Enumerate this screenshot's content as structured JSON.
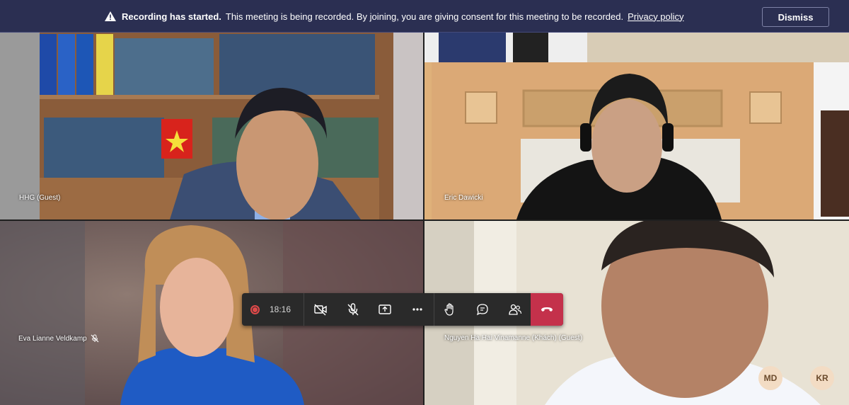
{
  "banner": {
    "title": "Recording has started.",
    "message": "This meeting is being recorded. By joining, you are giving consent for this meeting to be recorded.",
    "link": "Privacy policy",
    "dismiss_label": "Dismiss"
  },
  "participants": [
    {
      "name": "HHG (Guest)"
    },
    {
      "name": "Eric Dawicki"
    },
    {
      "name": "Eva Lianne Veldkamp",
      "mic": "mic-off-icon"
    },
    {
      "name": "Nguyen Ha Hai Vinamanne (Khách) (Guest)"
    }
  ],
  "toolbar": {
    "timer": "18:16",
    "buttons": [
      "camera-off-icon",
      "mic-off-icon",
      "share-screen-icon",
      "more-icon",
      "raise-hand-icon",
      "chat-icon",
      "participants-icon",
      "hang-up-icon"
    ]
  },
  "avatars": [
    {
      "initials": "MD"
    },
    {
      "initials": "KR"
    }
  ],
  "colors": {
    "banner_bg": "#2b2f52",
    "toolbar_bg": "#2a2a2a",
    "hangup": "#c4314b",
    "record": "#e04a4a",
    "avatar_bg": "#f3dcc4"
  }
}
